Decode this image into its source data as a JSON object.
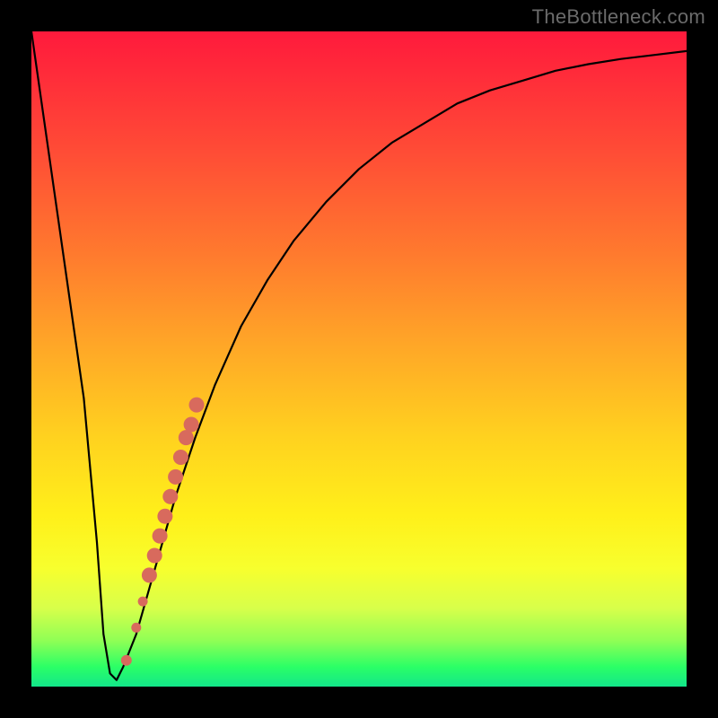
{
  "watermark": "TheBottleneck.com",
  "chart_data": {
    "type": "line",
    "title": "",
    "xlabel": "",
    "ylabel": "",
    "xlim": [
      0,
      100
    ],
    "ylim": [
      0,
      100
    ],
    "grid": false,
    "legend": false,
    "series": [
      {
        "name": "bottleneck-curve",
        "x": [
          0,
          2,
          4,
          6,
          8,
          10,
          11,
          12,
          13,
          14,
          16,
          18,
          20,
          22,
          25,
          28,
          32,
          36,
          40,
          45,
          50,
          55,
          60,
          65,
          70,
          75,
          80,
          85,
          90,
          95,
          100
        ],
        "y": [
          100,
          86,
          72,
          58,
          44,
          22,
          8,
          2,
          1,
          3,
          8,
          15,
          22,
          29,
          38,
          46,
          55,
          62,
          68,
          74,
          79,
          83,
          86,
          89,
          91,
          92.5,
          94,
          95,
          95.8,
          96.4,
          97
        ]
      }
    ],
    "markers": [
      {
        "name": "highlight-dots",
        "points": [
          {
            "x": 14.5,
            "y": 4
          },
          {
            "x": 16.0,
            "y": 9
          },
          {
            "x": 17.0,
            "y": 13
          },
          {
            "x": 18.0,
            "y": 17
          },
          {
            "x": 18.8,
            "y": 20
          },
          {
            "x": 19.6,
            "y": 23
          },
          {
            "x": 20.4,
            "y": 26
          },
          {
            "x": 21.2,
            "y": 29
          },
          {
            "x": 22.0,
            "y": 32
          },
          {
            "x": 22.8,
            "y": 35
          },
          {
            "x": 23.6,
            "y": 38
          },
          {
            "x": 24.4,
            "y": 40
          },
          {
            "x": 25.2,
            "y": 43
          }
        ],
        "color": "#d86a5d"
      }
    ],
    "background_gradient": {
      "orientation": "vertical",
      "stops": [
        {
          "pos": 0.0,
          "color": "#ff1a3c"
        },
        {
          "pos": 0.5,
          "color": "#ffb726"
        },
        {
          "pos": 0.78,
          "color": "#fff01a"
        },
        {
          "pos": 1.0,
          "color": "#12e68a"
        }
      ]
    }
  }
}
